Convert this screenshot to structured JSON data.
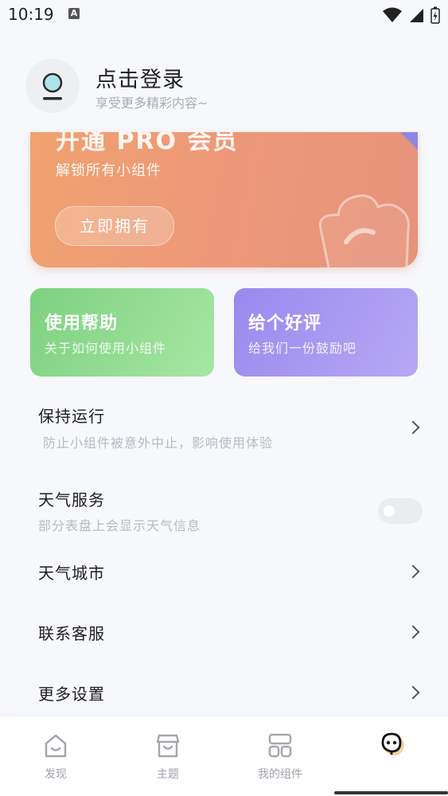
{
  "status_bar": {
    "time": "10:19",
    "notification_icon": "A"
  },
  "header": {
    "title": "点击登录",
    "subtitle": "享受更多精彩内容~"
  },
  "pro_banner": {
    "title": "开通 PRO 会员",
    "subtitle": "解锁所有小组件",
    "button_label": "立即拥有"
  },
  "cards": {
    "help": {
      "title": "使用帮助",
      "subtitle": "关于如何使用小组件"
    },
    "rate": {
      "title": "给个好评",
      "subtitle": "给我们一份鼓励吧"
    }
  },
  "settings": {
    "keep_running": {
      "title": "保持运行",
      "subtitle": "防止小组件被意外中止，影响使用体验"
    },
    "weather_service": {
      "title": "天气服务",
      "subtitle": "部分表盘上会显示天气信息",
      "enabled": false
    },
    "weather_city": {
      "title": "天气城市"
    },
    "contact": {
      "title": "联系客服"
    },
    "more": {
      "title": "更多设置"
    }
  },
  "bottom_nav": {
    "discover": "发现",
    "theme": "主题",
    "my_widgets": "我的组件",
    "active_tab": "mine"
  }
}
